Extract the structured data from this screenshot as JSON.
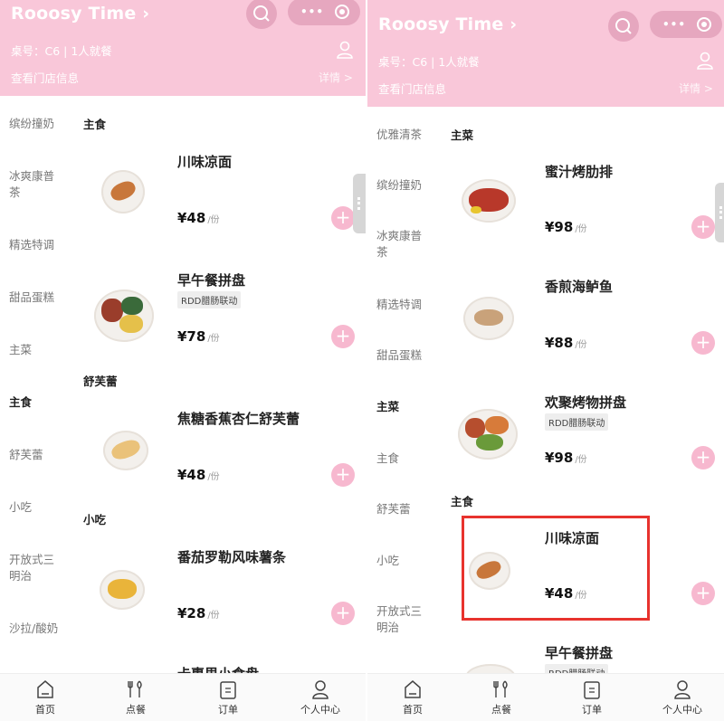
{
  "store": {
    "name": "Rooosy Time",
    "table_info": "桌号：C6 | 1人就餐",
    "store_info_link": "查看门店信息",
    "details_link": "详情 >"
  },
  "left_panel": {
    "sidebar": [
      "缤纷撞奶",
      "冰爽康普茶",
      "精选特调",
      "甜品蛋糕",
      "主菜",
      "主食",
      "舒芙蕾",
      "小吃",
      "开放式三明治",
      "沙拉/酸奶"
    ],
    "sidebar_active": "主食",
    "sections": [
      "主食",
      "舒芙蕾",
      "小吃"
    ],
    "dishes": [
      {
        "name": "川味凉面",
        "price": "¥48",
        "unit": "/份",
        "tag": ""
      },
      {
        "name": "早午餐拼盘",
        "price": "¥78",
        "unit": "/份",
        "tag": "RDD腊肠联动"
      },
      {
        "name": "焦糖香蕉杏仁舒芙蕾",
        "price": "¥48",
        "unit": "/份",
        "tag": ""
      },
      {
        "name": "番茄罗勒风味薯条",
        "price": "¥28",
        "unit": "/份",
        "tag": ""
      },
      {
        "name": "卡惠里小食盘",
        "price": "",
        "unit": "",
        "tag": ""
      }
    ]
  },
  "right_panel": {
    "sidebar": [
      "优雅清茶",
      "缤纷撞奶",
      "冰爽康普茶",
      "精选特调",
      "甜品蛋糕",
      "主菜",
      "主食",
      "舒芙蕾",
      "小吃",
      "开放式三明治"
    ],
    "sidebar_active": "主菜",
    "sections": [
      "主菜",
      "主食"
    ],
    "dishes": [
      {
        "name": "蜜汁烤肋排",
        "price": "¥98",
        "unit": "/份",
        "tag": ""
      },
      {
        "name": "香煎海鲈鱼",
        "price": "¥88",
        "unit": "/份",
        "tag": ""
      },
      {
        "name": "欢聚烤物拼盘",
        "price": "¥98",
        "unit": "/份",
        "tag": "RDD腊肠联动"
      },
      {
        "name": "川味凉面",
        "price": "¥48",
        "unit": "/份",
        "tag": ""
      },
      {
        "name": "早午餐拼盘",
        "price": "",
        "unit": "",
        "tag": "RDD腊肠联动"
      }
    ]
  },
  "tabbar": [
    {
      "label": "首页",
      "icon": "home-icon"
    },
    {
      "label": "点餐",
      "icon": "utensils-icon"
    },
    {
      "label": "订单",
      "icon": "order-icon"
    },
    {
      "label": "个人中心",
      "icon": "person-icon"
    }
  ],
  "colors": {
    "header_bg": "#f9c7d9",
    "accent": "#f7b8cf",
    "highlight": "#e8332e"
  }
}
